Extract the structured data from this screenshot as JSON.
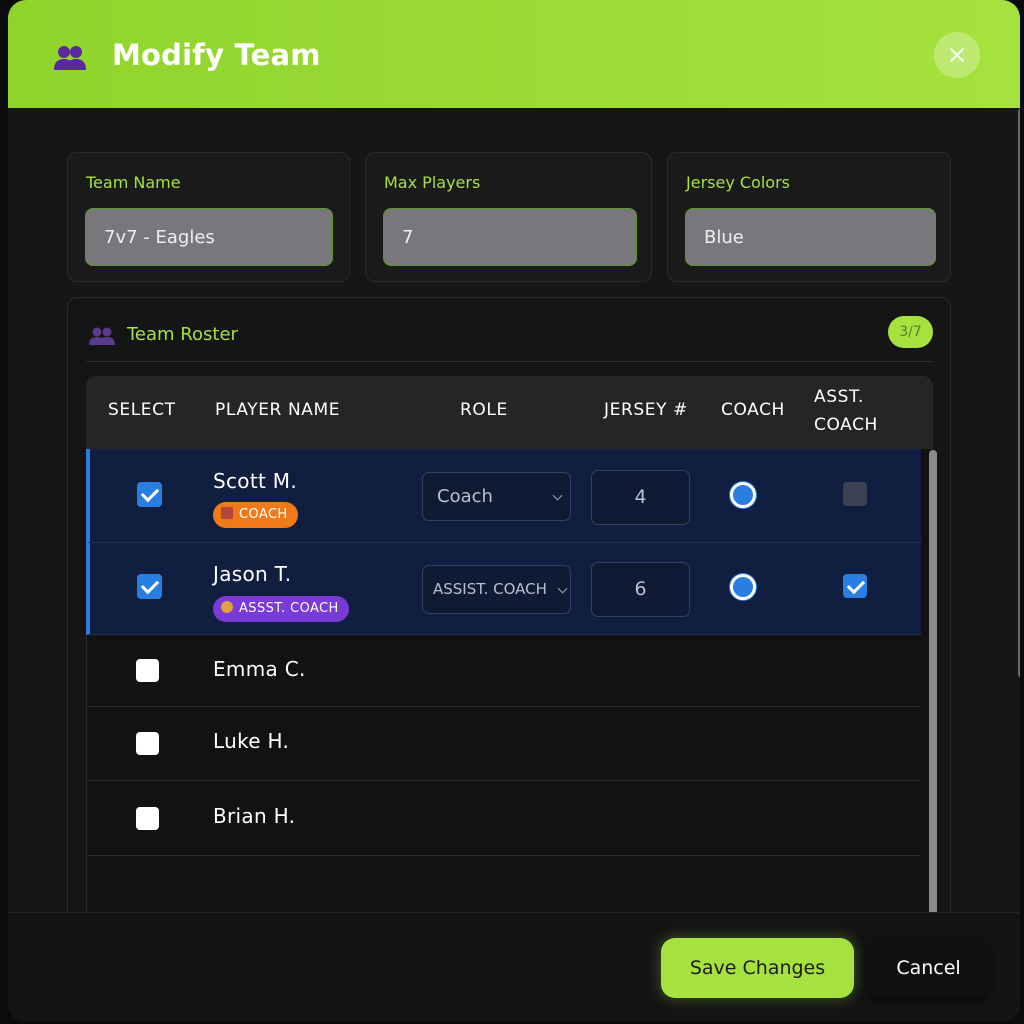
{
  "dialog": {
    "title": "Modify Team",
    "header_color": "#a6e23e"
  },
  "fields": {
    "team_name": {
      "label": "Team Name",
      "value": "7v7 - Eagles"
    },
    "max_players": {
      "label": "Max Players",
      "value": "7"
    },
    "jersey_colors": {
      "label": "Jersey Colors",
      "value": "Blue"
    }
  },
  "roster": {
    "title": "Team Roster",
    "count": "3/7",
    "columns": {
      "select": "SELECT",
      "player_name": "PLAYER NAME",
      "role": "ROLE",
      "jersey": "JERSEY #",
      "coach": "COACH",
      "asst_line1": "ASST.",
      "asst_line2": "COACH"
    },
    "rows": [
      {
        "name": "Scott M.",
        "selected": true,
        "badge": "COACH",
        "role": "Coach",
        "jersey": "4",
        "coach": true,
        "asst_coach": false
      },
      {
        "name": "Jason T.",
        "selected": true,
        "badge": "ASSST. COACH",
        "role": "ASSIST. COACH",
        "jersey": "6",
        "coach": true,
        "asst_coach": true
      },
      {
        "name": "Emma C.",
        "selected": false
      },
      {
        "name": "Luke H.",
        "selected": false
      },
      {
        "name": "Brian H.",
        "selected": false
      }
    ]
  },
  "footer": {
    "save_label": "Save Changes",
    "cancel_label": "Cancel"
  },
  "icons": {
    "header": "users-icon",
    "roster": "users-icon",
    "close": "close-icon"
  }
}
